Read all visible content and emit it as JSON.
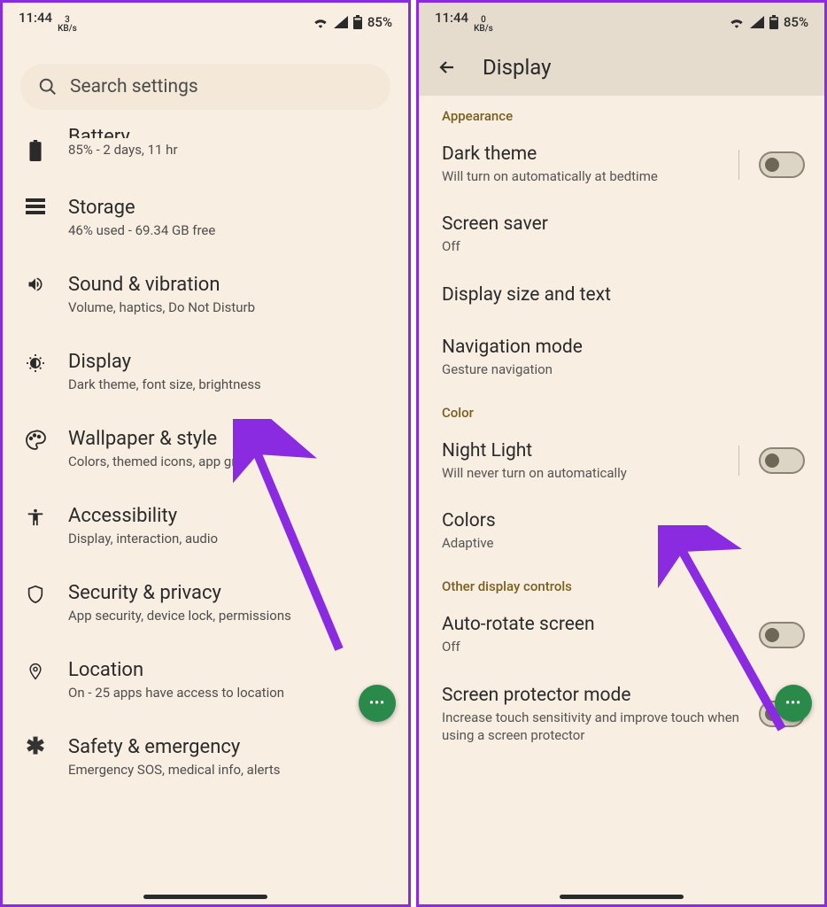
{
  "left": {
    "statusbar": {
      "time": "11:44",
      "kbs_num": "3",
      "kbs_unit": "KB/s",
      "battery": "85%"
    },
    "search_placeholder": "Search settings",
    "items": [
      {
        "icon": "battery",
        "title": "Battery",
        "subtitle": "85% - 2 days, 11 hr",
        "cut": true
      },
      {
        "icon": "storage",
        "title": "Storage",
        "subtitle": "46% used - 69.34 GB free"
      },
      {
        "icon": "sound",
        "title": "Sound & vibration",
        "subtitle": "Volume, haptics, Do Not Disturb"
      },
      {
        "icon": "display",
        "title": "Display",
        "subtitle": "Dark theme, font size, brightness"
      },
      {
        "icon": "wallpaper",
        "title": "Wallpaper & style",
        "subtitle": "Colors, themed icons, app grid"
      },
      {
        "icon": "accessibility",
        "title": "Accessibility",
        "subtitle": "Display, interaction, audio"
      },
      {
        "icon": "security",
        "title": "Security & privacy",
        "subtitle": "App security, device lock, permissions"
      },
      {
        "icon": "location",
        "title": "Location",
        "subtitle": "On - 25 apps have access to location"
      },
      {
        "icon": "safety",
        "title": "Safety & emergency",
        "subtitle": "Emergency SOS, medical info, alerts"
      }
    ]
  },
  "right": {
    "statusbar": {
      "time": "11:44",
      "kbs_num": "0",
      "kbs_unit": "KB/s",
      "battery": "85%"
    },
    "appbar_title": "Display",
    "sections": {
      "appearance": "Appearance",
      "color": "Color",
      "other": "Other display controls"
    },
    "items": {
      "dark_theme": {
        "title": "Dark theme",
        "sub": "Will turn on automatically at bedtime"
      },
      "screen_saver": {
        "title": "Screen saver",
        "sub": "Off"
      },
      "display_size": {
        "title": "Display size and text"
      },
      "nav_mode": {
        "title": "Navigation mode",
        "sub": "Gesture navigation"
      },
      "night_light": {
        "title": "Night Light",
        "sub": "Will never turn on automatically"
      },
      "colors": {
        "title": "Colors",
        "sub": "Adaptive"
      },
      "auto_rotate": {
        "title": "Auto-rotate screen",
        "sub": "Off"
      },
      "protector": {
        "title": "Screen protector mode",
        "sub": "Increase touch sensitivity and improve touch when using a screen protector"
      }
    }
  }
}
